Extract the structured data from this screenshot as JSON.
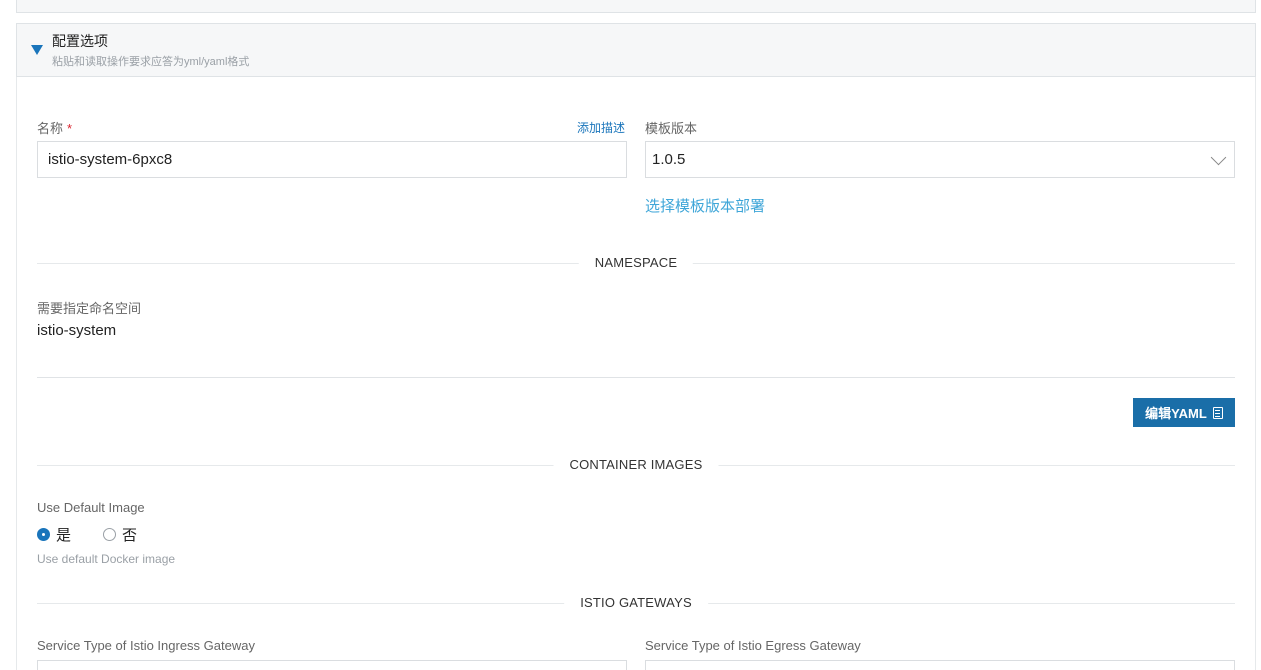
{
  "section": {
    "title": "配置选项",
    "subtitle": "粘贴和读取操作要求应答为yml/yaml格式"
  },
  "name_field": {
    "label": "名称",
    "required_mark": "*",
    "add_desc_link": "添加描述",
    "value": "istio-system-6pxc8"
  },
  "template_version": {
    "label": "模板版本",
    "selected": "1.0.5",
    "choose_link": "选择模板版本部署"
  },
  "namespace": {
    "divider": "NAMESPACE",
    "label": "需要指定命名空间",
    "value": "istio-system"
  },
  "toolbar": {
    "edit_yaml_label": "编辑YAML"
  },
  "container_images": {
    "divider": "CONTAINER IMAGES",
    "label": "Use Default Image",
    "options": [
      "是",
      "否"
    ],
    "selected_index": 0,
    "hint": "Use default Docker image"
  },
  "istio_gateways": {
    "divider": "ISTIO GATEWAYS",
    "ingress_label": "Service Type of Istio Ingress Gateway",
    "egress_label": "Service Type of Istio Egress Gateway"
  }
}
